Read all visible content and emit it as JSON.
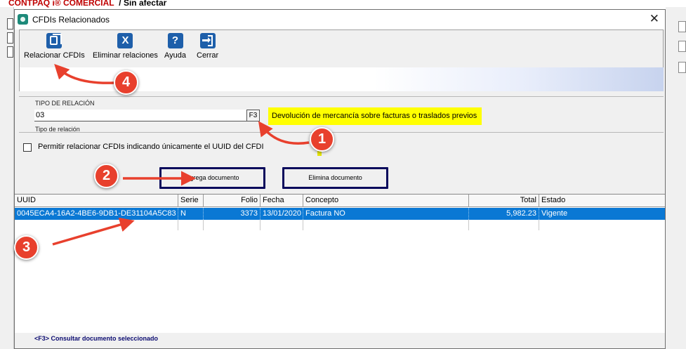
{
  "background": {
    "app_title": "CONTPAQ i® COMERCIAL",
    "app_subtitle": "/ Sin afectar"
  },
  "dialog": {
    "title": "CFDIs Relacionados",
    "close_glyph": "✕"
  },
  "toolbar": {
    "relate_label": "Relacionar CFDIs",
    "remove_label": "Eliminar relaciones",
    "help_label": "Ayuda",
    "help_glyph": "?",
    "remove_glyph": "X",
    "close_label": "Cerrar"
  },
  "relation": {
    "label": "TIPO DE RELACIÓN",
    "value": "03",
    "lookup_label": "F3",
    "description": "Devolución de mercancía sobre facturas o traslados previos",
    "caption": "Tipo de relación"
  },
  "options": {
    "uuid_only_label": "Permitir relacionar CFDIs indicando únicamente el UUID del CFDI"
  },
  "actions": {
    "add_label": "Agrega documento",
    "delete_label": "Elimina documento"
  },
  "table": {
    "columns": [
      "UUID",
      "Serie",
      "Folio",
      "Fecha",
      "Concepto",
      "Total",
      "Estado"
    ],
    "rows": [
      {
        "uuid": "0045ECA4-16A2-4BE6-9DB1-DE31104A5C83",
        "serie": "N",
        "folio": "3373",
        "fecha": "13/01/2020",
        "concepto": "Factura NO",
        "total": "5,982.23",
        "estado": "Vigente"
      }
    ]
  },
  "status": {
    "hint": "<F3> Consultar documento seleccionado"
  },
  "callouts": [
    "1",
    "2",
    "3",
    "4"
  ],
  "colors": {
    "accent_blue": "#1e5faa",
    "selection": "#0a78d4",
    "highlight_yellow": "#ffff00",
    "callout_red": "#e8402d",
    "button_border": "#0a0a5c"
  }
}
